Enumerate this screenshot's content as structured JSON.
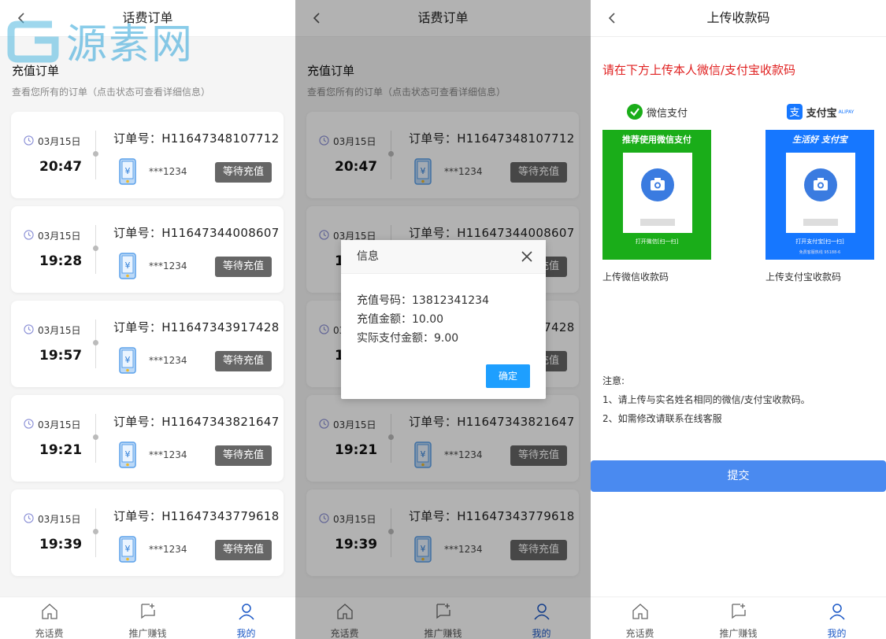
{
  "watermark": {
    "text": "源素网"
  },
  "orders_page": {
    "title": "话费订单",
    "heading": "充值订单",
    "subheading": "查看您所有的订单（点击状态可查看详细信息）",
    "order_no_prefix": "订单号：",
    "orders": [
      {
        "date": "03月15日",
        "time": "20:47",
        "order_no": "H11647348107712",
        "phone": "***1234",
        "status": "等待充值"
      },
      {
        "date": "03月15日",
        "time": "19:28",
        "order_no": "H11647344008607",
        "phone": "***1234",
        "status": "等待充值"
      },
      {
        "date": "03月15日",
        "time": "19:57",
        "order_no": "H11647343917428",
        "phone": "***1234",
        "status": "等待充值"
      },
      {
        "date": "03月15日",
        "time": "19:21",
        "order_no": "H11647343821647",
        "phone": "***1234",
        "status": "等待充值"
      },
      {
        "date": "03月15日",
        "time": "19:39",
        "order_no": "H11647343779618",
        "phone": "***1234",
        "status": "等待充值"
      }
    ]
  },
  "dialog": {
    "title": "信息",
    "line1": "充值号码：13812341234",
    "line2": "充值金额：10.00",
    "line3": "实际支付金额：9.00",
    "ok_label": "确定"
  },
  "upload_page": {
    "title": "上传收款码",
    "tip": "请在下方上传本人微信/支付宝收款码",
    "wechat": {
      "brand": "微信支付",
      "banner": "推荐使用微信支付",
      "foot": "打开微信[扫一扫]",
      "label": "上传微信收款码",
      "color": "#1aad19"
    },
    "alipay": {
      "brand": "支付宝",
      "brand_sub": "ALIPAY",
      "banner": "生活好 支付宝",
      "foot": "打开支付宝[扫一扫]",
      "foot2": "免费客服热线 95188-6",
      "label": "上传支付宝收款码",
      "color": "#1677ff"
    },
    "notes_title": "注意:",
    "note1": "1、请上传与实名姓名相同的微信/支付宝收款码。",
    "note2": "2、如需修改请联系在线客服",
    "submit_label": "提交"
  },
  "tabbar": {
    "items": [
      {
        "label": "充话费",
        "icon": "home-icon"
      },
      {
        "label": "推广赚钱",
        "icon": "share-icon"
      },
      {
        "label": "我的",
        "icon": "user-icon"
      }
    ],
    "active_color": "#1a57c6"
  }
}
